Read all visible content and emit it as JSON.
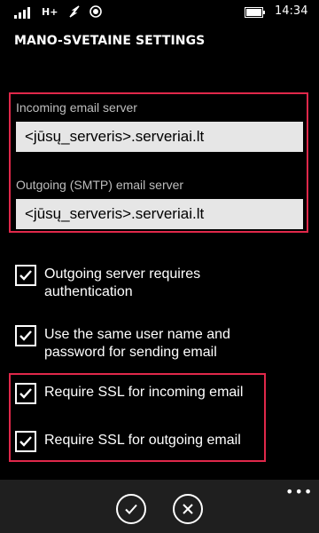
{
  "status_bar": {
    "network": "H+",
    "time": "14:34",
    "icons": [
      "signal-icon",
      "wifi-icon",
      "location-icon",
      "battery-icon"
    ]
  },
  "page": {
    "title": "MANO-SVETAINE SETTINGS"
  },
  "servers": {
    "incoming_label": "Incoming email server",
    "incoming_value": "<jūsų_serveris>.serveriai.lt",
    "outgoing_label": "Outgoing (SMTP) email server",
    "outgoing_value": "<jūsų_serveris>.serveriai.lt"
  },
  "options": [
    {
      "label": "Outgoing server requires authentication",
      "checked": true
    },
    {
      "label": "Use the same user name and password for sending email",
      "checked": true
    },
    {
      "label": "Require SSL for incoming email",
      "checked": true
    },
    {
      "label": "Require SSL for outgoing email",
      "checked": true
    }
  ],
  "app_bar": {
    "buttons": [
      "done-icon",
      "cancel-icon"
    ],
    "more": "•••"
  },
  "colors": {
    "background": "#000000",
    "highlight_border": "#e0284a",
    "input_background": "#e6e6e6",
    "label_gray": "#bdbdbd",
    "app_bar": "#1f1f1f"
  }
}
